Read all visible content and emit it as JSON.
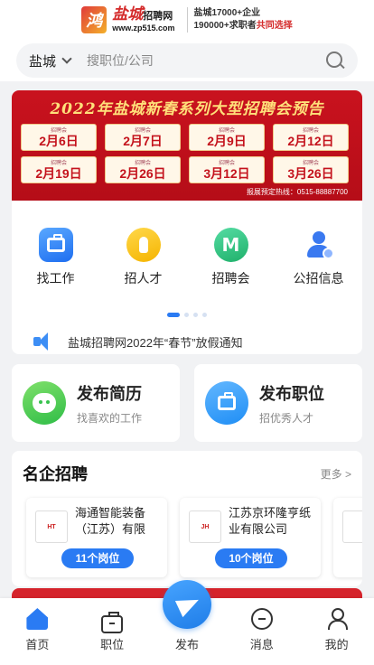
{
  "header": {
    "logo_mark": "鸿",
    "logo_name": "盐城",
    "logo_name_suffix": "招聘网",
    "logo_url": "www.zp515.com",
    "stat_line1": "盐城17000+企业",
    "stat_line2_prefix": "190000+求职者",
    "stat_line2_highlight": "共同选择"
  },
  "search": {
    "city": "盐城",
    "placeholder": "搜职位/公司"
  },
  "banner": {
    "title": "2022年盐城新春系列大型招聘会预告",
    "dates": [
      "2月6日",
      "2月7日",
      "2月9日",
      "2月12日",
      "2月19日",
      "2月26日",
      "3月12日",
      "3月26日"
    ],
    "hotline": "报展预定热线：0515-88887700"
  },
  "nav": [
    {
      "label": "找工作",
      "icon": "briefcase-icon"
    },
    {
      "label": "招人才",
      "icon": "hand-icon"
    },
    {
      "label": "招聘会",
      "icon": "fair-icon"
    },
    {
      "label": "公招信息",
      "icon": "person-badge-icon"
    }
  ],
  "notice": {
    "text": "盐城招聘网2022年“春节”放假通知"
  },
  "quick": {
    "resume_title": "发布简历",
    "resume_sub": "找喜欢的工作",
    "job_title": "发布职位",
    "job_sub": "招优秀人才"
  },
  "famous": {
    "title": "名企招聘",
    "more": "更多 >",
    "companies": [
      {
        "name": "海通智能装备（江苏）有限",
        "jobs": "11个岗位"
      },
      {
        "name": "江苏京环隆亨纸业有限公司",
        "jobs": "10个岗位"
      }
    ]
  },
  "tabbar": {
    "home": "首页",
    "jobs": "职位",
    "publish": "发布",
    "messages": "消息",
    "me": "我的"
  },
  "colors": {
    "accent": "#2a7bf3",
    "brand_red": "#d42b2b"
  }
}
